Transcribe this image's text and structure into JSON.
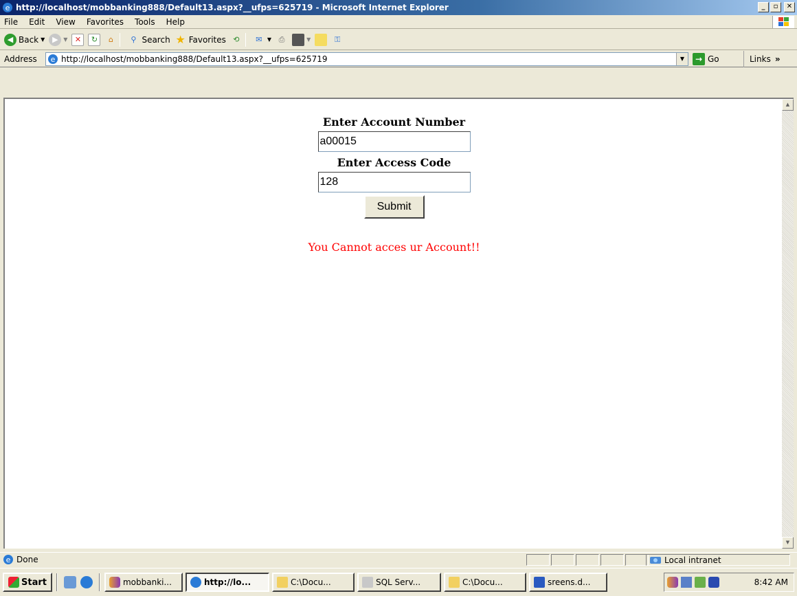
{
  "window": {
    "title": "http://localhost/mobbanking888/Default13.aspx?__ufps=625719 - Microsoft Internet Explorer"
  },
  "menu": [
    "File",
    "Edit",
    "View",
    "Favorites",
    "Tools",
    "Help"
  ],
  "toolbar": {
    "back": "Back",
    "search": "Search",
    "favorites": "Favorites"
  },
  "address": {
    "label": "Address",
    "url": "http://localhost/mobbanking888/Default13.aspx?__ufps=625719",
    "go": "Go",
    "links": "Links"
  },
  "form": {
    "account_label": "Enter Account Number",
    "account_value": "a00015",
    "access_label": "Enter Access Code",
    "access_value": "128",
    "submit_label": "Submit",
    "error_message": "You Cannot acces ur Account!!",
    "error_color": "#ff0000"
  },
  "status": {
    "text": "Done",
    "zone": "Local intranet"
  },
  "taskbar": {
    "start": "Start",
    "tasks": [
      "mobbanki...",
      "http://lo...",
      "C:\\Docu...",
      "SQL Serv...",
      "C:\\Docu...",
      "sreens.d..."
    ],
    "clock": "8:42 AM"
  }
}
